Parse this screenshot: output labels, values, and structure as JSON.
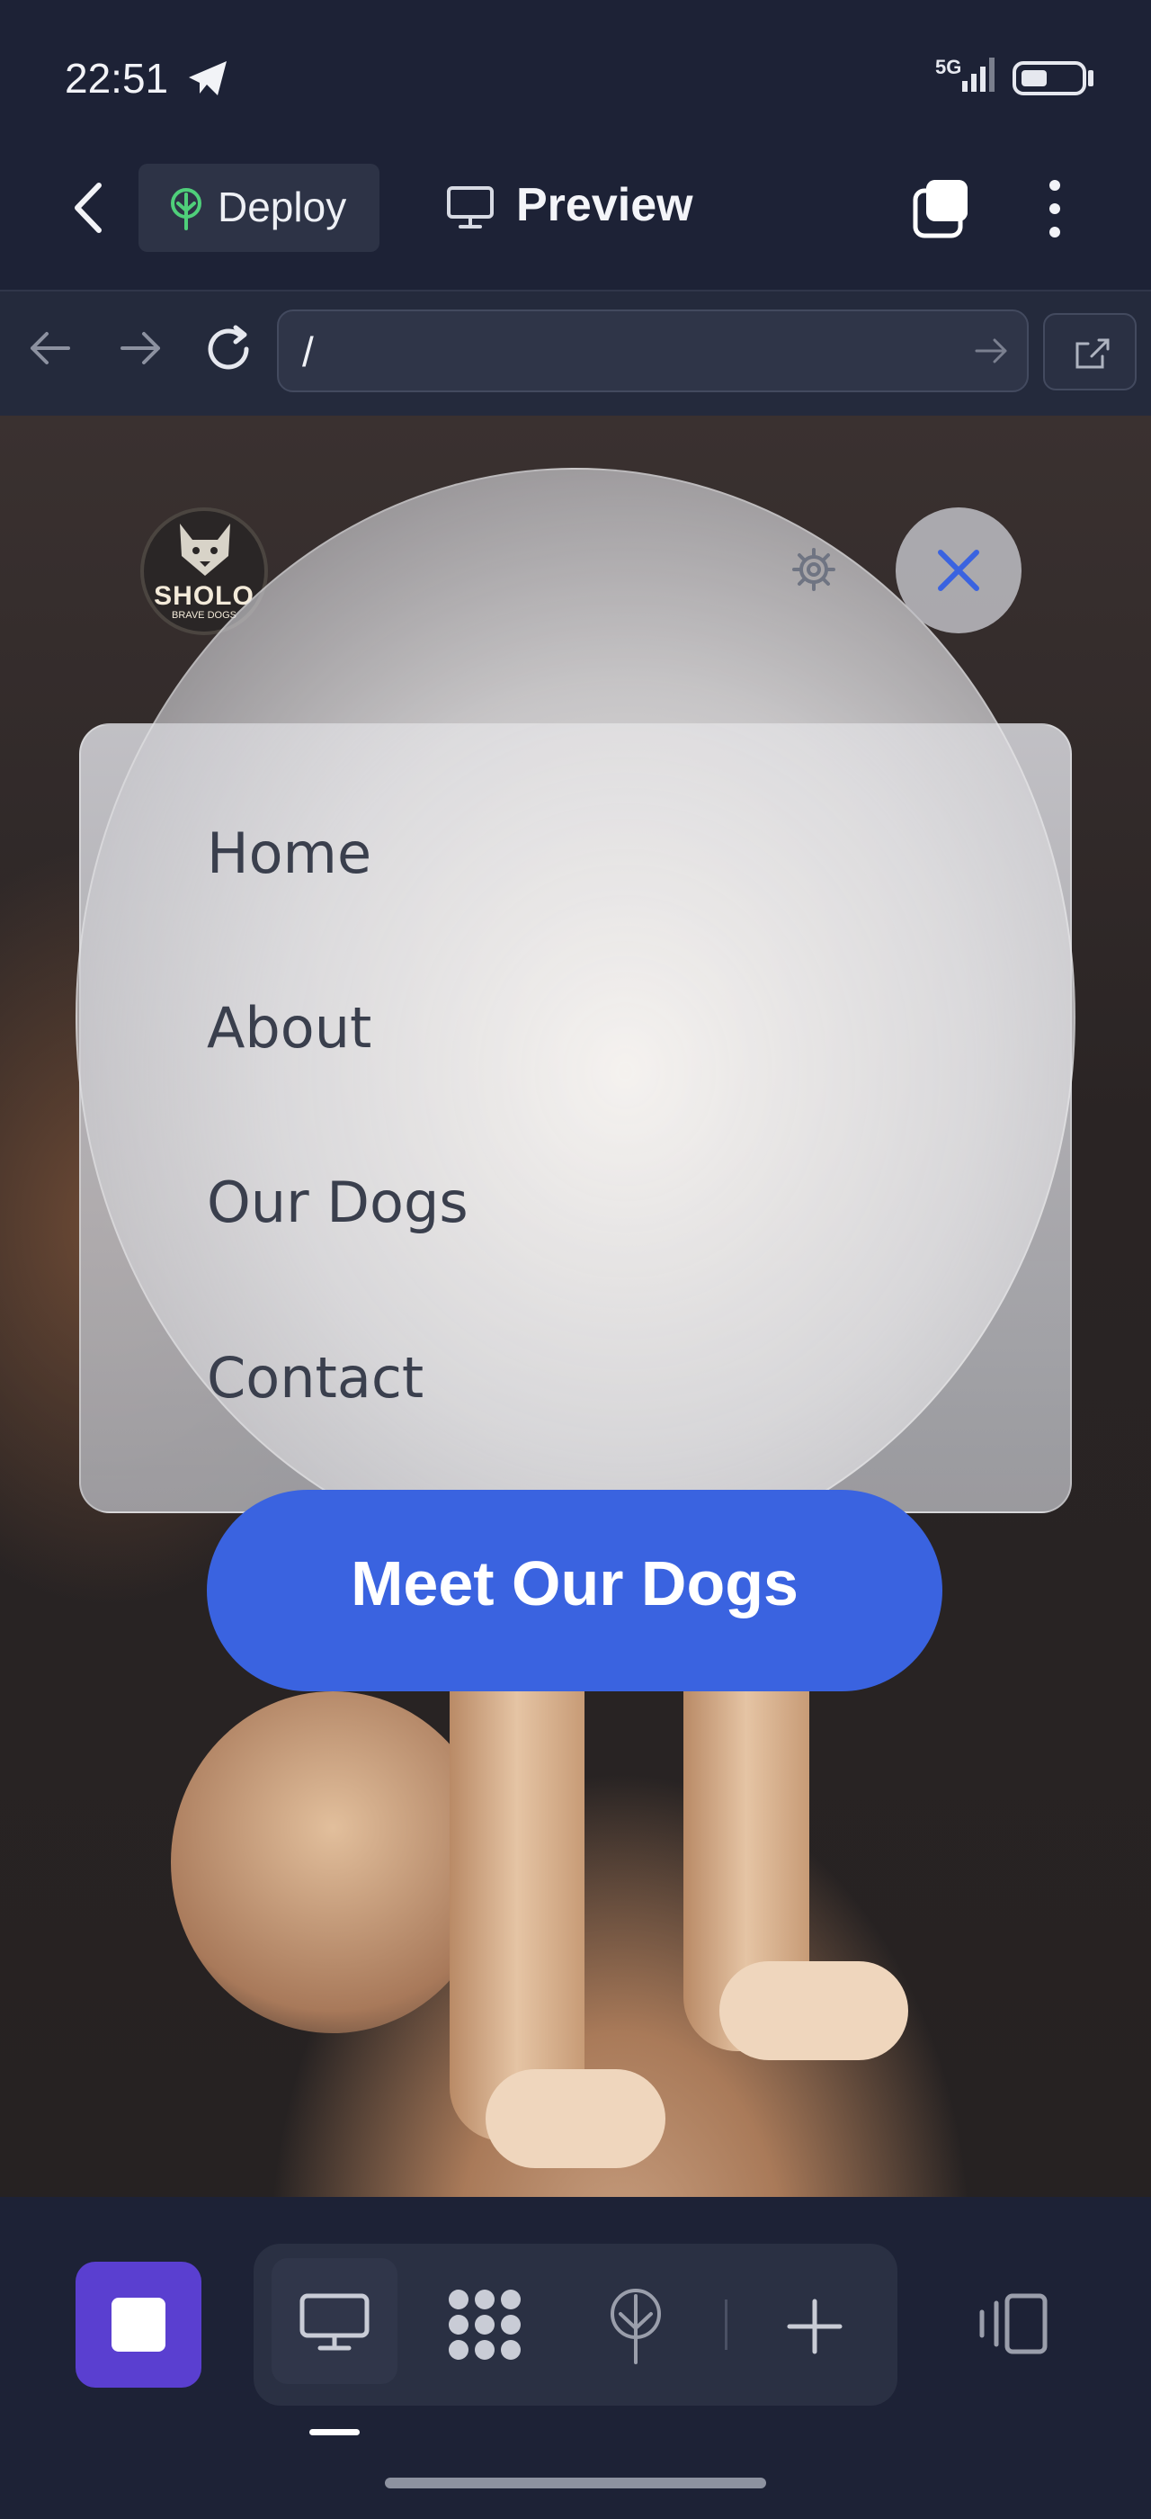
{
  "status_bar": {
    "time": "22:51",
    "network": "5G",
    "battery_level": 0.45,
    "icons": [
      "telegram-send-icon",
      "signal-icon",
      "battery-icon"
    ]
  },
  "header": {
    "deploy_label": "Deploy",
    "preview_label": "Preview",
    "icons": [
      "back-icon",
      "deploy-tree-icon",
      "monitor-icon",
      "windows-icon",
      "more-vert-icon"
    ]
  },
  "browser": {
    "url": "/",
    "icons": [
      "arrow-left-icon",
      "arrow-right-icon",
      "reload-icon",
      "go-arrow-icon",
      "open-external-icon"
    ]
  },
  "site": {
    "logo_text": "SHOLO",
    "logo_subtext": "BRAVE DOGS",
    "menu": [
      {
        "label": "Home"
      },
      {
        "label": "About"
      },
      {
        "label": "Our Dogs"
      },
      {
        "label": "Contact"
      }
    ],
    "cta_label": "Meet Our Dogs",
    "icons": [
      "gear-icon",
      "close-icon"
    ]
  },
  "toolbar": {
    "icons": [
      "stop-icon",
      "desktop-icon",
      "components-icon",
      "deploy-icon",
      "add-icon",
      "device-icon"
    ]
  },
  "colors": {
    "accent": "#3a63e0",
    "stop_button": "#5a3fd0",
    "background": "#1d2236"
  }
}
